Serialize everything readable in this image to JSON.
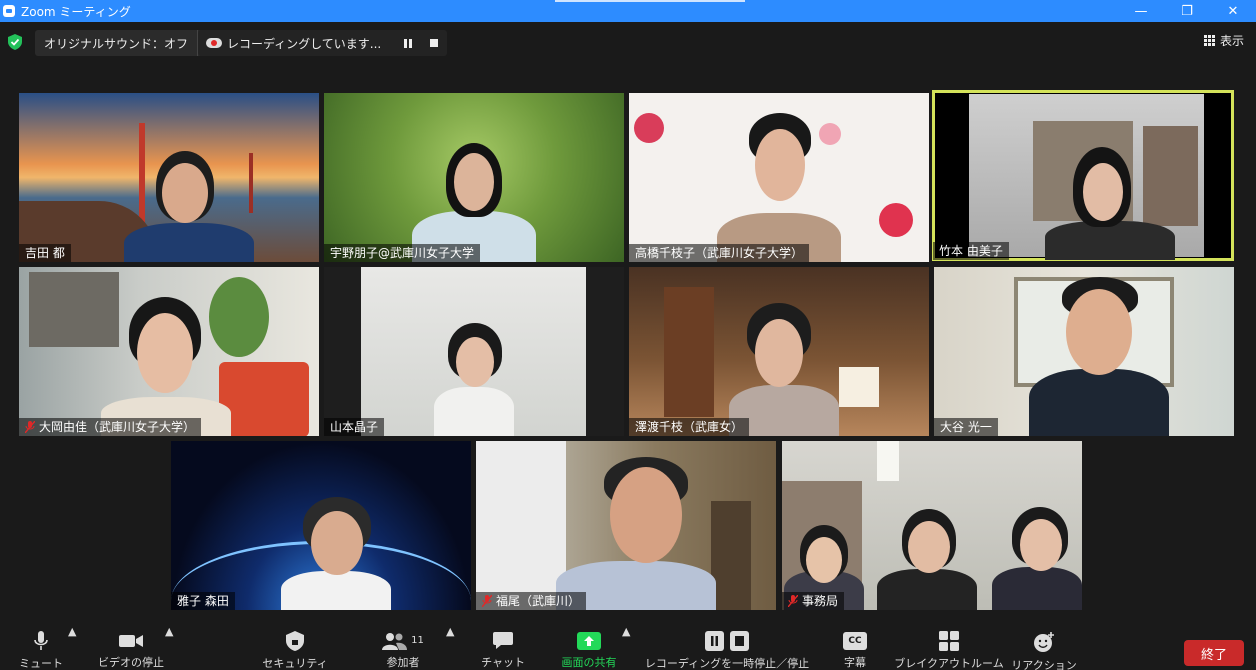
{
  "window": {
    "title": "Zoom ミーティング"
  },
  "topbar": {
    "audio_label": "オリジナルサウンド：オフ",
    "recording_label": "レコーディングしています...",
    "view_label": "表示"
  },
  "participants": [
    {
      "name": "吉田 都",
      "muted": false
    },
    {
      "name": "宇野朋子@武庫川女子大学",
      "muted": false
    },
    {
      "name": "高橋千枝子（武庫川女子大学）",
      "muted": false
    },
    {
      "name": "竹本 由美子",
      "muted": false,
      "active_speaker": true
    },
    {
      "name": "大岡由佳（武庫川女子大学）",
      "muted": true
    },
    {
      "name": "山本晶子",
      "muted": false
    },
    {
      "name": "澤渡千枝（武庫女）",
      "muted": false
    },
    {
      "name": "大谷 光一",
      "muted": false
    },
    {
      "name": "雅子 森田",
      "muted": false
    },
    {
      "name": "福尾（武庫川）",
      "muted": true
    },
    {
      "name": "事務局",
      "muted": true
    }
  ],
  "toolbar": {
    "mute": "ミュート",
    "video_stop": "ビデオの停止",
    "security": "セキュリティ",
    "participants": "参加者",
    "participants_count": "11",
    "chat": "チャット",
    "share_screen": "画面の共有",
    "recording_pause": "レコーディングを一時停止／停止",
    "captions": "字幕",
    "breakout": "ブレイクアウトルーム",
    "reactions": "リアクション",
    "end": "終了",
    "cc_text": "CC"
  },
  "colors": {
    "accent_blue": "#2d8cff",
    "share_green": "#23d959",
    "end_red": "#c92a2a",
    "active_speaker": "#d4e35a",
    "muted_red": "#e02828"
  }
}
